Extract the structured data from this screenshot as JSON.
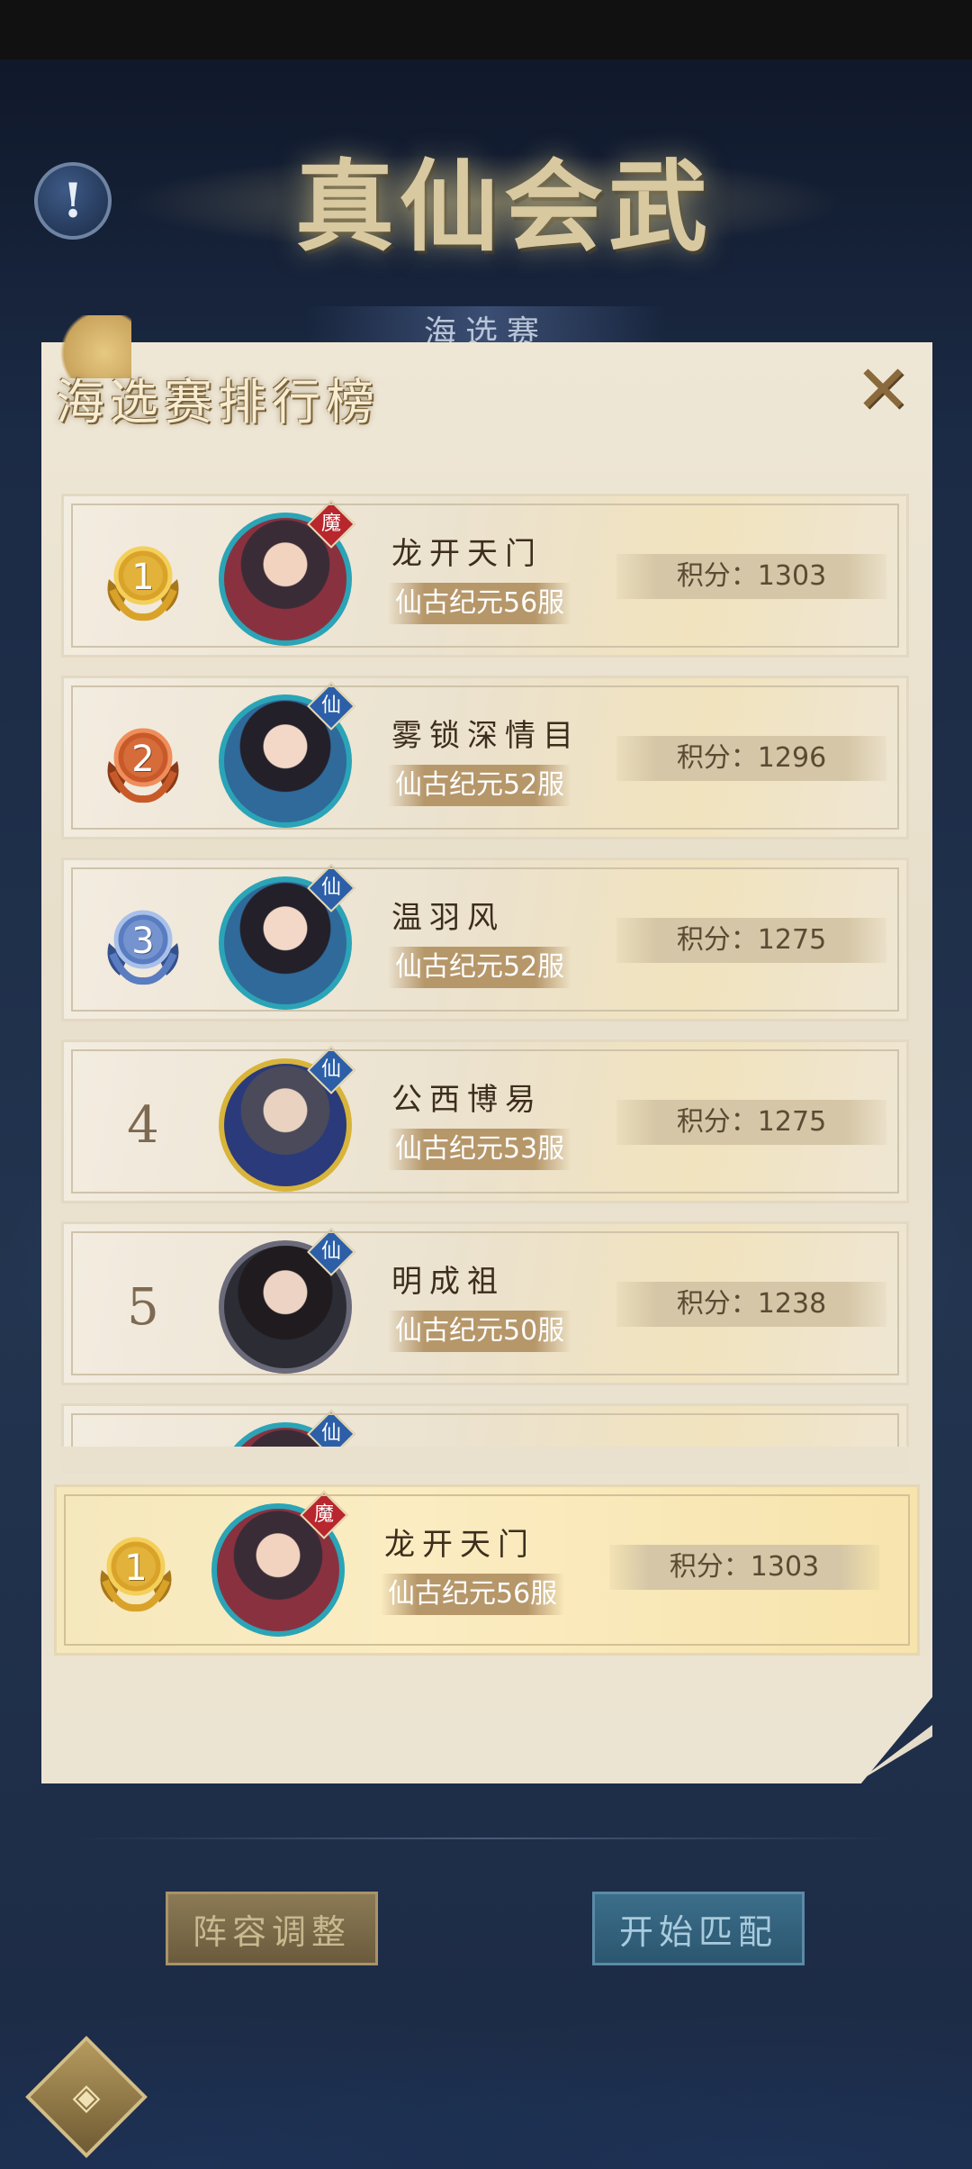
{
  "header": {
    "game_title": "真仙会武",
    "sub_banner": "海选赛",
    "info_symbol": "!"
  },
  "panel": {
    "title": "海选赛排行榜",
    "close_symbol": "✕"
  },
  "rankings": [
    {
      "rank": "1",
      "medal": "gold",
      "name": "龙开天门",
      "server": "仙古纪元56服",
      "faction": "魔",
      "score": "积分：1303"
    },
    {
      "rank": "2",
      "medal": "bronze",
      "name": "雾锁深情目",
      "server": "仙古纪元52服",
      "faction": "仙",
      "score": "积分：1296"
    },
    {
      "rank": "3",
      "medal": "blue",
      "name": "温羽风",
      "server": "仙古纪元52服",
      "faction": "仙",
      "score": "积分：1275"
    },
    {
      "rank": "4",
      "medal": "none",
      "name": "公西博易",
      "server": "仙古纪元53服",
      "faction": "仙",
      "score": "积分：1275"
    },
    {
      "rank": "5",
      "medal": "none",
      "name": "明成祖",
      "server": "仙古纪元50服",
      "faction": "仙",
      "score": "积分：1238"
    },
    {
      "rank": "",
      "medal": "none",
      "name": "",
      "server": "",
      "faction": "仙",
      "score": ""
    }
  ],
  "my_rank": {
    "rank": "1",
    "medal": "gold",
    "name": "龙开天门",
    "server": "仙古纪元56服",
    "faction": "魔",
    "score": "积分：1303"
  },
  "buttons": {
    "lineup": "阵容调整",
    "match": "开始匹配"
  },
  "colors": {
    "medal_gold": "#d9a32a",
    "medal_bronze": "#c85a2a",
    "medal_blue": "#5a7cc0",
    "faction_xian": "#2c5fa8",
    "faction_mo": "#b8262e"
  }
}
